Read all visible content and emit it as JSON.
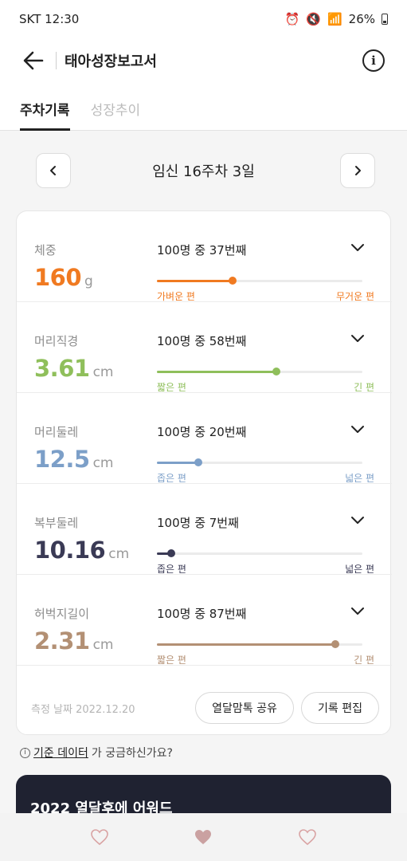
{
  "status_bar": {
    "time": "SKT 12:30",
    "battery": "26%"
  },
  "app_bar": {
    "title": "태아성장보고서"
  },
  "tabs": [
    {
      "label": "주차기록",
      "active": true
    },
    {
      "label": "성장추이",
      "active": false
    }
  ],
  "week": {
    "title": "임신 16주차 3일"
  },
  "measurements": [
    {
      "label": "체중",
      "value": "160",
      "unit": "g",
      "rank": "100명 중 37번째",
      "percent": 37,
      "min_label": "가벼운 편",
      "max_label": "무거운 편",
      "color": "#f07a21"
    },
    {
      "label": "머리직경",
      "value": "3.61",
      "unit": "cm",
      "rank": "100명 중 58번째",
      "percent": 58,
      "min_label": "짧은 편",
      "max_label": "긴 편",
      "color": "#8fbf5b"
    },
    {
      "label": "머리둘레",
      "value": "12.5",
      "unit": "cm",
      "rank": "100명 중 20번째",
      "percent": 20,
      "min_label": "좁은 편",
      "max_label": "넓은 편",
      "color": "#7c9fc8"
    },
    {
      "label": "복부둘레",
      "value": "10.16",
      "unit": "cm",
      "rank": "100명 중 7번째",
      "percent": 7,
      "min_label": "좁은 편",
      "max_label": "넓은 편",
      "color": "#3a3a55"
    },
    {
      "label": "허벅지길이",
      "value": "2.31",
      "unit": "cm",
      "rank": "100명 중 87번째",
      "percent": 87,
      "min_label": "짧은 편",
      "max_label": "긴 편",
      "color": "#b39074"
    }
  ],
  "footer": {
    "date_label": "측정 날짜 2022.12.20",
    "share_label": "열달맘톡 공유",
    "edit_label": "기록 편집"
  },
  "help": {
    "link_text": "기준 데이터",
    "rest_text": "가 궁금하신가요?"
  },
  "banner": {
    "title": "2022 열달후에 어워드"
  },
  "bottom_nav": [
    {
      "icon": "heart-outline-icon",
      "color": "#d9a3a3"
    },
    {
      "icon": "heart-filled-icon",
      "color": "#caa1a1"
    },
    {
      "icon": "heart-outline-icon",
      "color": "#d9a3a3"
    }
  ]
}
